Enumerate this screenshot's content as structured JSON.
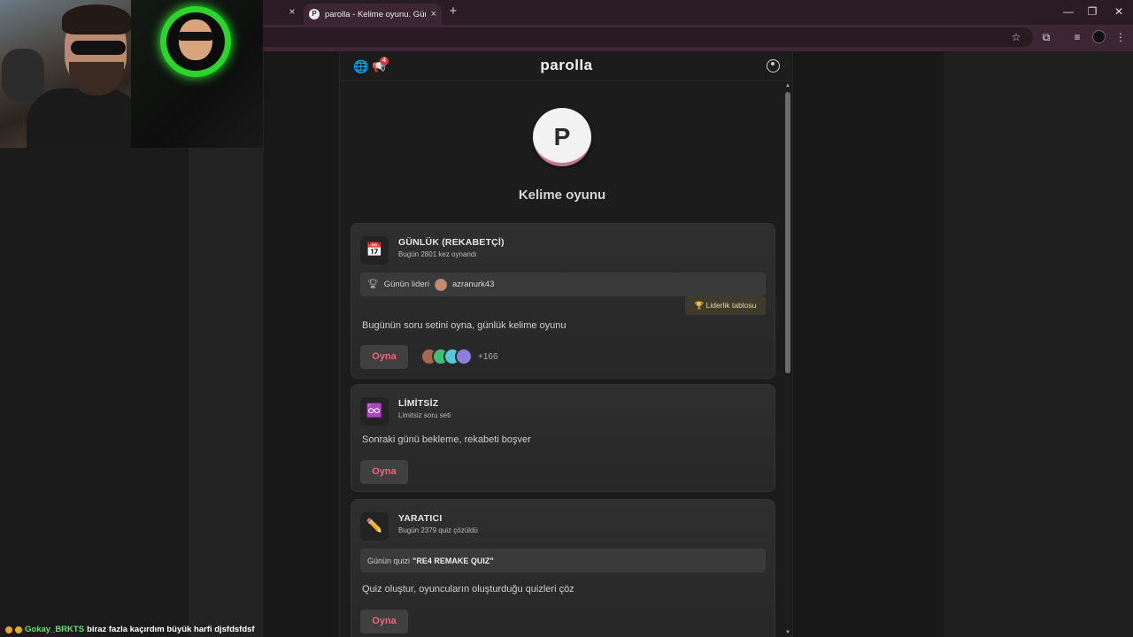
{
  "browser": {
    "tab_title": "parolla - Kelime oyunu. Günlük",
    "tab_favicon": "P",
    "tab_close": "×",
    "prev_tab_close": "×",
    "new_tab": "+",
    "window_controls": {
      "minimize": "—",
      "restore": "❐",
      "close": "✕"
    },
    "toolbar_icons": {
      "star": "☆",
      "extensions": "⧉",
      "media": "≡",
      "menu": "⋮"
    }
  },
  "header": {
    "brand": "parolla",
    "globe_icon": "🌐",
    "megaphone_icon": "📢",
    "notification_count": "4"
  },
  "hero": {
    "logo_letter": "P",
    "subtitle": "Kelime oyunu"
  },
  "cards": [
    {
      "icon": "📅",
      "title": "GÜNLÜK (REKABETÇİ)",
      "subtitle": "Bugün 2801 kez oynandı",
      "leader_label": "Günün lideri",
      "leader_name": "azranurk43",
      "leaderboard_button": "🏆 Liderlik tablosu",
      "description": "Bugünün soru setini oyna, günlük kelime oyunu",
      "play_label": "Oyna",
      "players_more": "+166"
    },
    {
      "icon": "♾️",
      "title": "LİMİTSİZ",
      "subtitle": "Limitsiz soru seti",
      "description": "Sonraki günü bekleme, rekabeti boşver",
      "play_label": "Oyna"
    },
    {
      "icon": "✏️",
      "title": "YARATICI",
      "subtitle": "Bugün 2379 quiz çözüldü",
      "quiz_label": "Günün quizi",
      "quiz_name": "\"RE4 REMAKE QUIZ\"",
      "description": "Quiz oluştur, oyuncuların oluşturduğu quizleri çöz",
      "play_label": "Oyna"
    }
  ],
  "chat": {
    "user": "Gokay_BRKTS",
    "message": "biraz fazla kaçırdım büyük harfi djsfdsfdsf"
  },
  "colors": {
    "accent_play": "#e8677a",
    "logo_ring": "#c9758a",
    "chat_user": "#67e36a",
    "browser_frame": "#3c2634"
  }
}
